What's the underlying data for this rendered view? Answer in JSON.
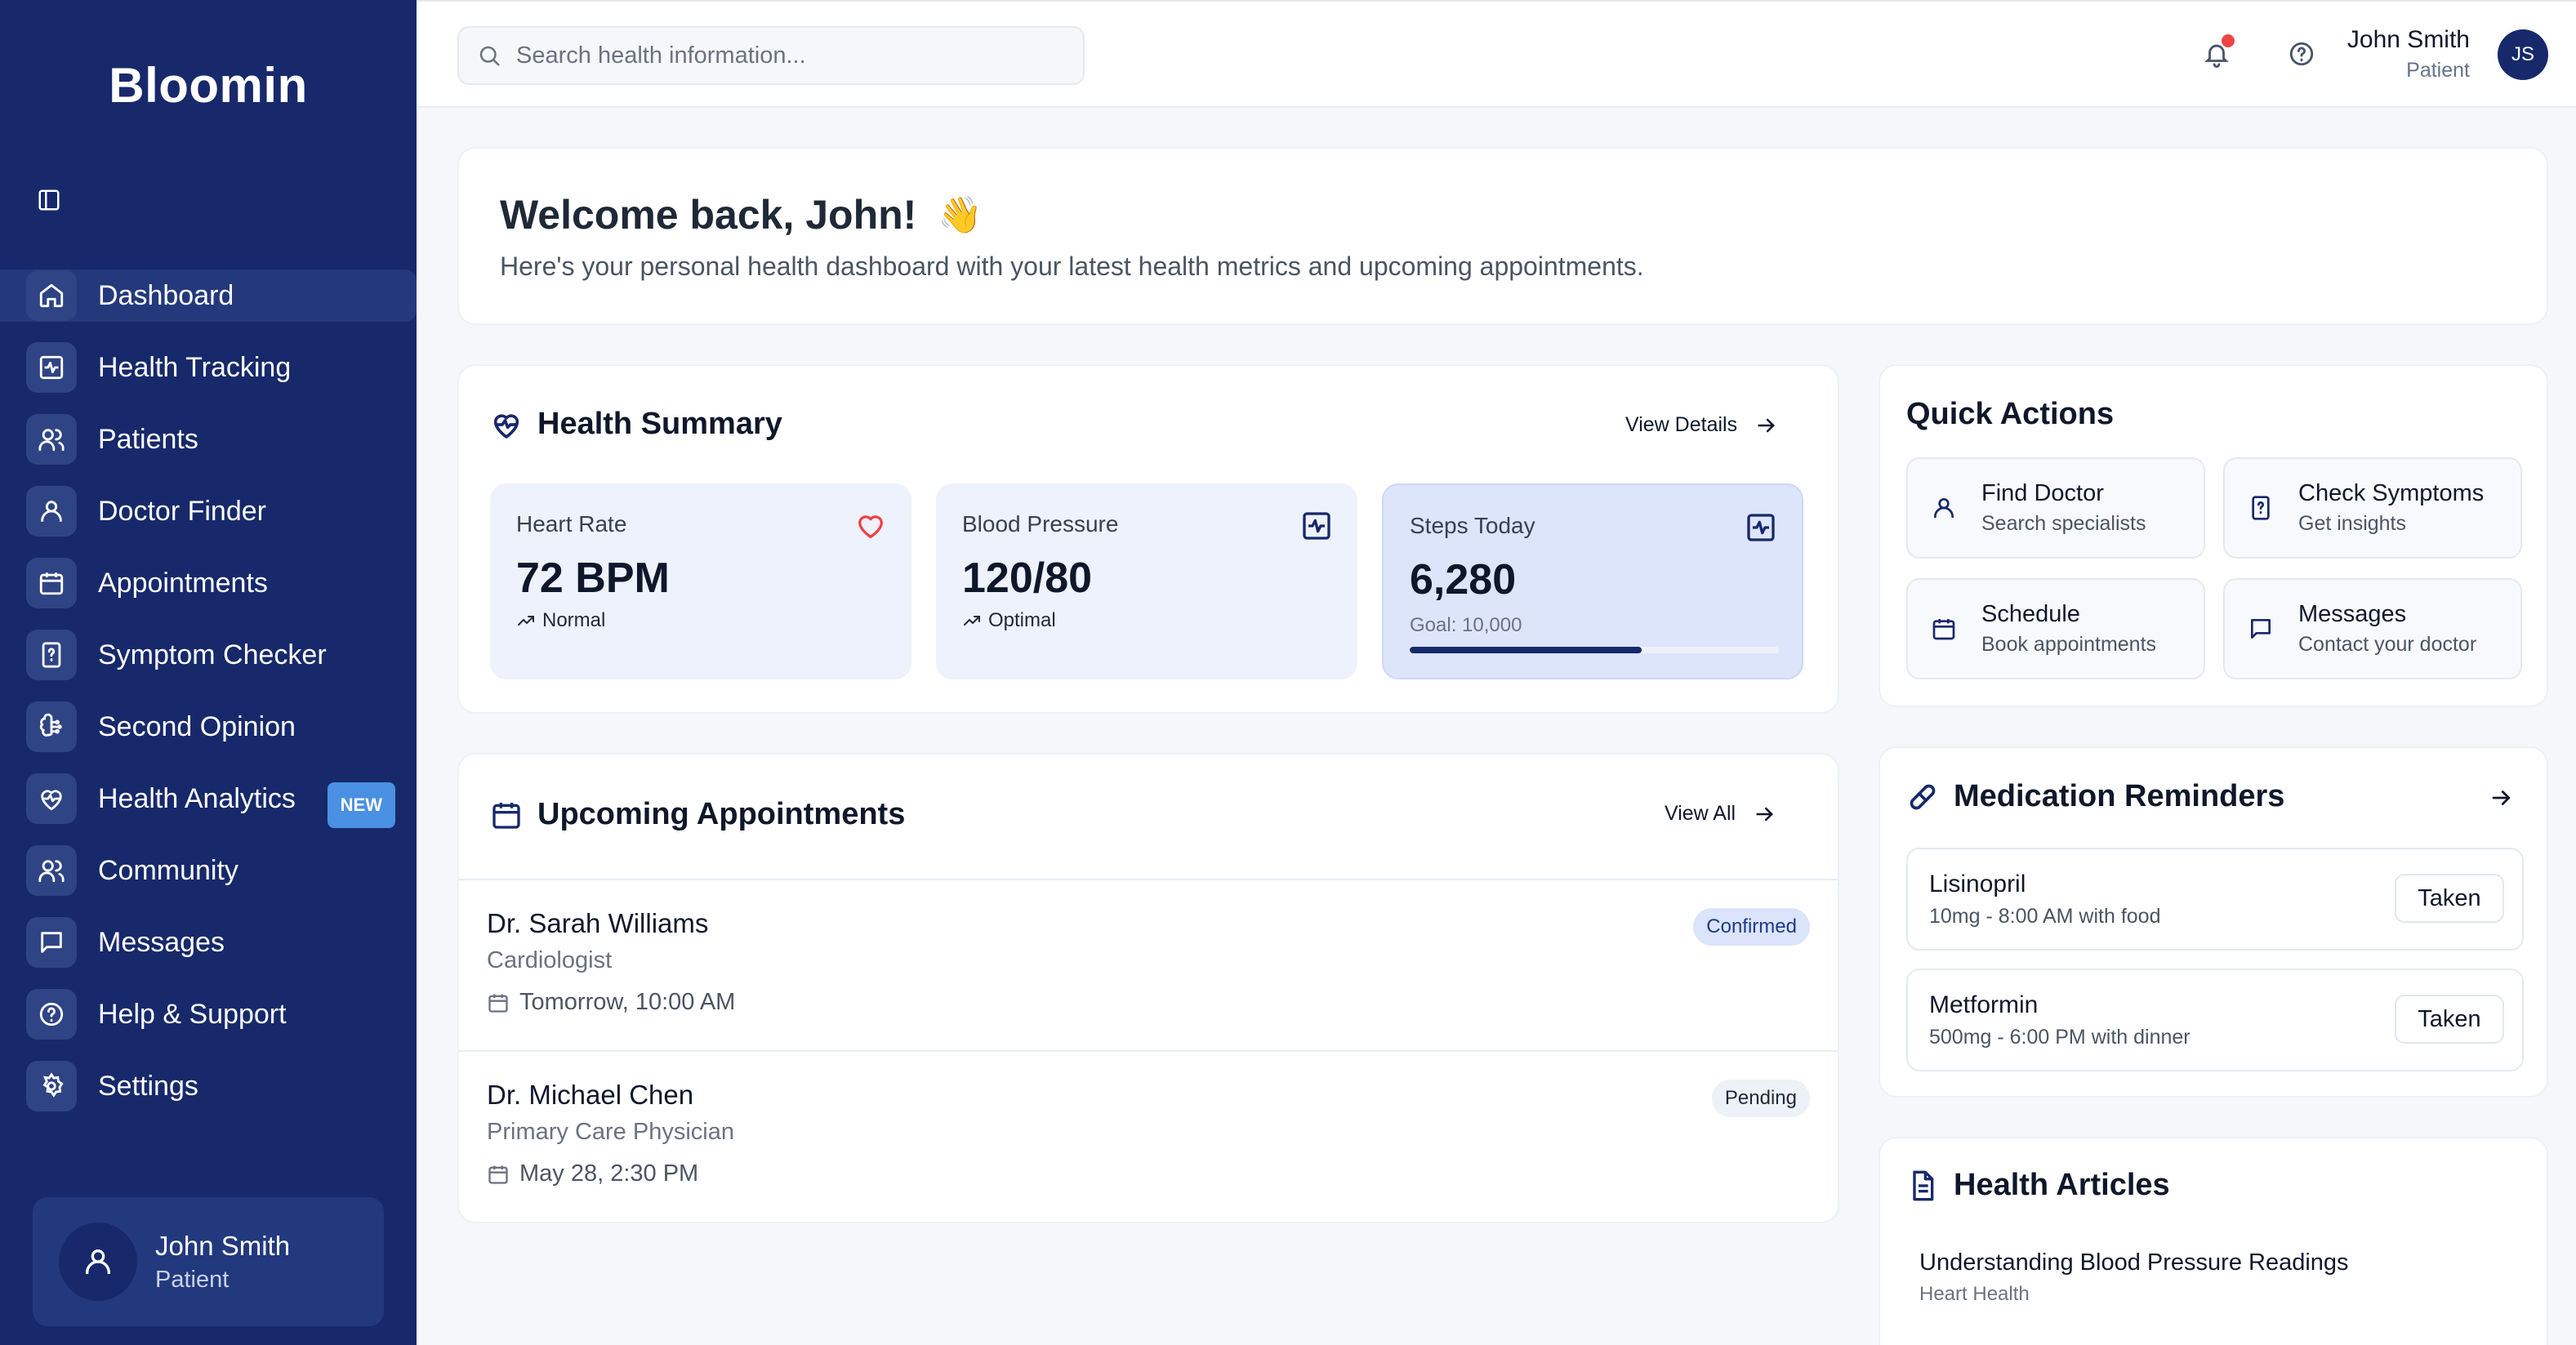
{
  "sidebar": {
    "brand": "Bloomin",
    "items": [
      {
        "label": "Dashboard"
      },
      {
        "label": "Health Tracking"
      },
      {
        "label": "Patients"
      },
      {
        "label": "Doctor Finder"
      },
      {
        "label": "Appointments"
      },
      {
        "label": "Symptom Checker"
      },
      {
        "label": "Second Opinion"
      },
      {
        "label": "Health Analytics",
        "badge": "NEW"
      },
      {
        "label": "Community"
      },
      {
        "label": "Messages"
      },
      {
        "label": "Help & Support"
      },
      {
        "label": "Settings"
      }
    ],
    "user": {
      "name": "John Smith",
      "role": "Patient"
    }
  },
  "topbar": {
    "search_placeholder": "Search health information...",
    "user": {
      "name": "John Smith",
      "role": "Patient",
      "initials": "JS"
    }
  },
  "welcome": {
    "title": "Welcome back, John!",
    "emoji": "👋",
    "subtitle": "Here's your personal health dashboard with your latest health metrics and upcoming appointments."
  },
  "summary": {
    "title": "Health Summary",
    "link": "View Details",
    "metrics": [
      {
        "label": "Heart Rate",
        "value": "72 BPM",
        "note": "Normal"
      },
      {
        "label": "Blood Pressure",
        "value": "120/80",
        "note": "Optimal"
      },
      {
        "label": "Steps Today",
        "value": "6,280",
        "note": "Goal: 10,000",
        "progress": 0.628
      }
    ]
  },
  "appointments": {
    "title": "Upcoming Appointments",
    "link": "View All",
    "items": [
      {
        "doctor": "Dr. Sarah Williams",
        "specialty": "Cardiologist",
        "when": "Tomorrow, 10:00 AM",
        "status": "Confirmed"
      },
      {
        "doctor": "Dr. Michael Chen",
        "specialty": "Primary Care Physician",
        "when": "May 28, 2:30 PM",
        "status": "Pending"
      }
    ]
  },
  "quick_actions": {
    "title": "Quick Actions",
    "items": [
      {
        "title": "Find Doctor",
        "subtitle": "Search specialists"
      },
      {
        "title": "Check Symptoms",
        "subtitle": "Get insights"
      },
      {
        "title": "Schedule",
        "subtitle": "Book appointments"
      },
      {
        "title": "Messages",
        "subtitle": "Contact your doctor"
      }
    ]
  },
  "medications": {
    "title": "Medication Reminders",
    "items": [
      {
        "name": "Lisinopril",
        "detail": "10mg - 8:00 AM with food",
        "action": "Taken"
      },
      {
        "name": "Metformin",
        "detail": "500mg - 6:00 PM with dinner",
        "action": "Taken"
      }
    ]
  },
  "articles": {
    "title": "Health Articles",
    "items": [
      {
        "title": "Understanding Blood Pressure Readings",
        "category": "Heart Health"
      }
    ]
  },
  "colors": {
    "sidebar_bg": "#17296b",
    "accent_blue": "#4a90e2",
    "heart_red": "#ef4444",
    "metric_bg": "#eef2fc"
  }
}
